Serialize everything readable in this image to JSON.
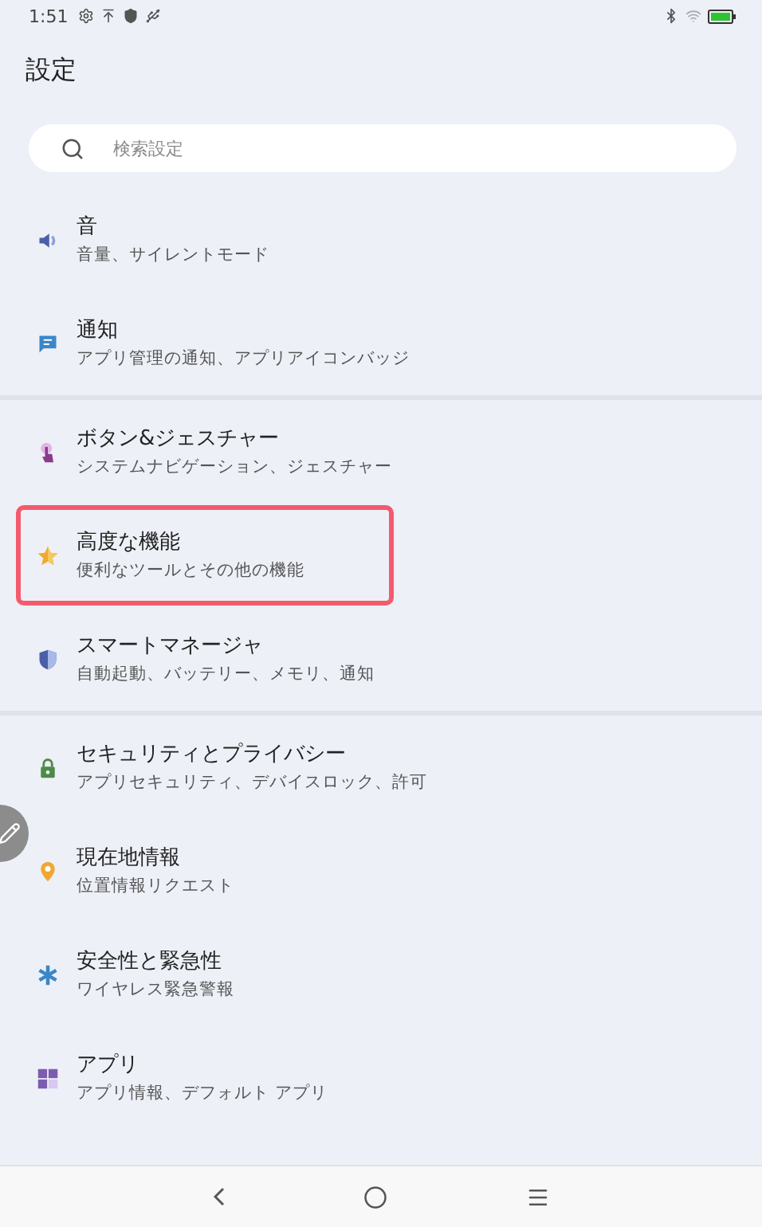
{
  "status_bar": {
    "time": "1:51"
  },
  "title": "設定",
  "search": {
    "placeholder": "検索設定"
  },
  "sections": [
    {
      "items": [
        {
          "title": "音",
          "subtitle": "音量、サイレントモード",
          "highlighted": false
        },
        {
          "title": "通知",
          "subtitle": "アプリ管理の通知、アプリアイコンバッジ",
          "highlighted": false
        }
      ]
    },
    {
      "items": [
        {
          "title": "ボタン&ジェスチャー",
          "subtitle": "システムナビゲーション、ジェスチャー",
          "highlighted": false
        },
        {
          "title": "高度な機能",
          "subtitle": "便利なツールとその他の機能",
          "highlighted": true
        },
        {
          "title": "スマートマネージャ",
          "subtitle": "自動起動、バッテリー、メモリ、通知",
          "highlighted": false
        }
      ]
    },
    {
      "items": [
        {
          "title": "セキュリティとプライバシー",
          "subtitle": "アプリセキュリティ、デバイスロック、許可",
          "highlighted": false
        },
        {
          "title": "現在地情報",
          "subtitle": "位置情報リクエスト",
          "highlighted": false
        },
        {
          "title": "安全性と緊急性",
          "subtitle": "ワイヤレス緊急警報",
          "highlighted": false
        },
        {
          "title": "アプリ",
          "subtitle": "アプリ情報、デフォルト アプリ",
          "highlighted": false
        }
      ]
    }
  ]
}
